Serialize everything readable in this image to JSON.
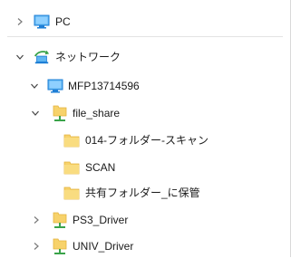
{
  "tree": {
    "pc": {
      "label": "PC",
      "icon": "monitor-icon",
      "expanded": false
    },
    "network": {
      "label": "ネットワーク",
      "icon": "network-icon",
      "expanded": true
    },
    "computer": {
      "label": "MFP13714596",
      "icon": "monitor-icon",
      "expanded": true
    },
    "share": {
      "label": "file_share",
      "icon": "network-share-folder-icon",
      "expanded": true
    },
    "folders": [
      {
        "label": "014-フォルダー-スキャン",
        "icon": "folder-icon"
      },
      {
        "label": "SCAN",
        "icon": "folder-icon"
      },
      {
        "label": "共有フォルダー_に保管",
        "icon": "folder-icon"
      }
    ],
    "shares": [
      {
        "label": "PS3_Driver",
        "icon": "network-share-folder-icon",
        "expanded": false
      },
      {
        "label": "UNIV_Driver",
        "icon": "network-share-folder-icon",
        "expanded": false
      }
    ]
  },
  "colors": {
    "folder": "#f7d26b",
    "folder_dark": "#e3b33d",
    "monitor": "#1e7fd6",
    "share_green": "#3aa34a",
    "chevron": "#7a7a7a"
  }
}
